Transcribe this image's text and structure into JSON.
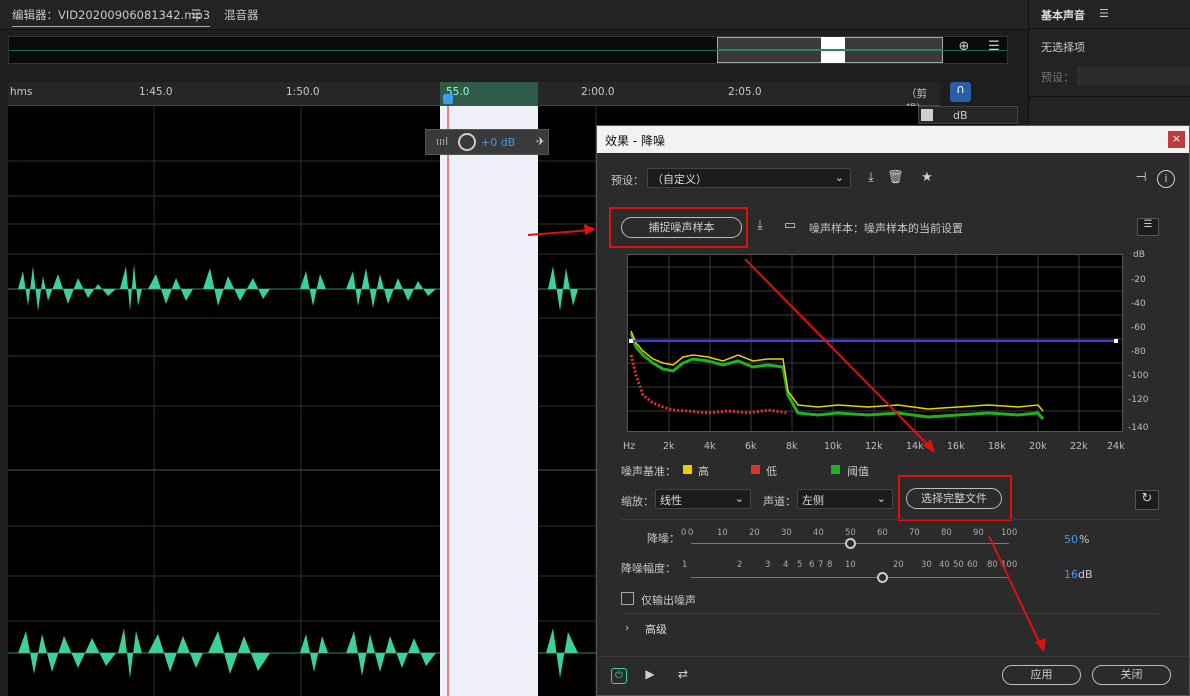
{
  "tabs": {
    "editor": "编辑器：VID20200906081342.mp3",
    "mixer": "混音器"
  },
  "timeline": {
    "hms": "hms",
    "ticks": [
      "1:45.0",
      "1:50.0",
      "",
      "2:00.0",
      "2:05.0"
    ],
    "clip_label": "（剪辑）",
    "sel_label": "55.0"
  },
  "hud": {
    "gain": "+0 dB"
  },
  "right_panel": {
    "title": "基本声音",
    "none_selected": "无选择项",
    "preset_label": "预设："
  },
  "db_col": {
    "label": "dB"
  },
  "dialog": {
    "title": "效果 - 降噪",
    "close": "×",
    "preset_label": "预设：",
    "preset_value": "（自定义）",
    "capture_button": "捕捉噪声样本",
    "noise_sample_text": "噪声样本：噪声样本的当前设置",
    "graph": {
      "y_labels": [
        "dB",
        "-20",
        "-40",
        "-60",
        "-80",
        "-100",
        "-120",
        "-140"
      ],
      "x_labels": [
        "Hz",
        "2k",
        "4k",
        "6k",
        "8k",
        "10k",
        "12k",
        "14k",
        "16k",
        "18k",
        "20k",
        "22k",
        "24k"
      ]
    },
    "legend": {
      "label": "噪声基准：",
      "high": "高",
      "low": "低",
      "threshold": "阈值",
      "colors": {
        "high": "#e8d000",
        "low": "#e03030",
        "threshold": "#20b020"
      }
    },
    "scale_label": "缩放：",
    "scale_value": "线性",
    "channel_label": "声道：",
    "channel_value": "左侧",
    "select_file_button": "选择完整文件",
    "reduction_label": "降噪：",
    "reduction_value": "50",
    "reduction_unit": "%",
    "reduction_scale": [
      "0",
      "0",
      "10",
      "20",
      "30",
      "40",
      "50",
      "60",
      "70",
      "80",
      "90",
      "100"
    ],
    "amount_label": "降噪幅度：",
    "amount_value": "16",
    "amount_unit": "dB",
    "amount_scale": [
      "1",
      "2",
      "3",
      "4",
      "5",
      "6",
      "7",
      "8",
      "10",
      "20",
      "30",
      "40",
      "50",
      "60",
      "80",
      "100"
    ],
    "output_noise_only": "仅输出噪声",
    "advanced": "高级",
    "apply_button": "应用",
    "close_button": "关闭"
  }
}
